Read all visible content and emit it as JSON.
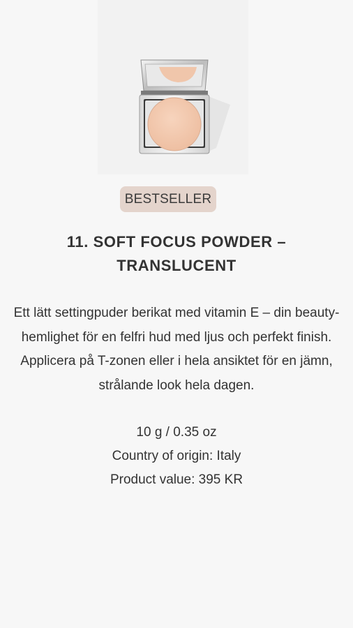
{
  "product": {
    "image_icon": "compact-powder-image",
    "badge": "BESTSELLER",
    "title": "11. SOFT FOCUS POWDER – TRANSLUCENT",
    "description": "Ett lätt settingpuder berikat med vitamin E – din beauty-hemlighet för en felfri hud med ljus och perfekt finish. Applicera på T-zonen eller i hela ansiktet för en jämn, strålande look hela dagen.",
    "weight": "10 g / 0.35 oz",
    "origin": "Country of origin: Italy",
    "value": "Product value: 395 KR"
  },
  "colors": {
    "background": "#f7f7f7",
    "badge_bg": "#e4d4cc",
    "text": "#333333",
    "powder": "#f2c8ad"
  }
}
